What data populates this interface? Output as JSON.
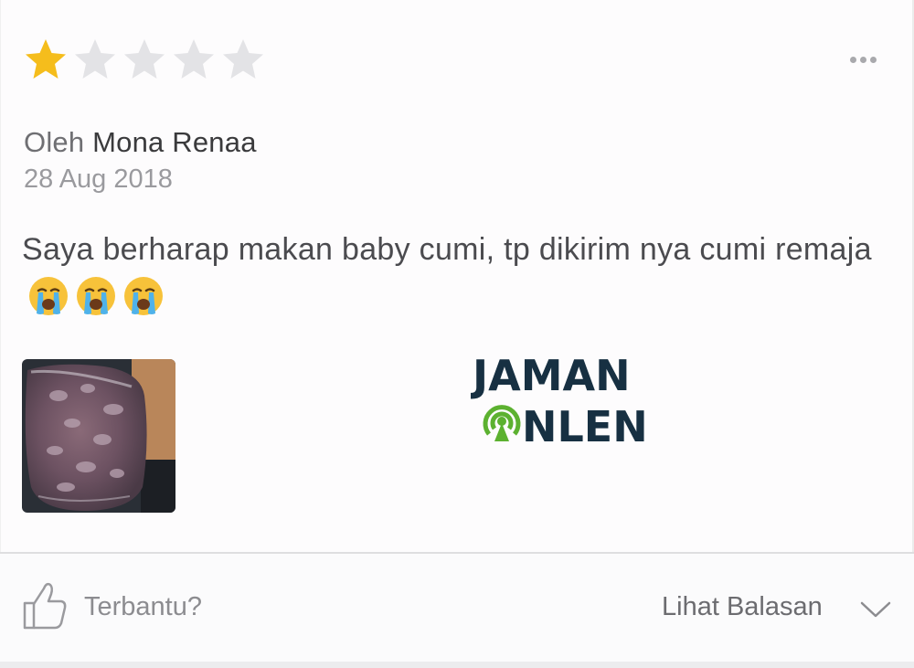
{
  "review": {
    "rating": 1,
    "rating_max": 5,
    "author_prefix": "Oleh",
    "author_name": "Mona Renaa",
    "date": "28 Aug 2018",
    "text": "Saya berharap makan baby cumi, tp dikirim nya cumi remaja",
    "emojis": [
      "crying-face",
      "crying-face",
      "crying-face"
    ]
  },
  "footer": {
    "helpful_label": "Terbantu?",
    "replies_label": "Lihat Balasan"
  },
  "watermark": {
    "line1": "JAMAN",
    "line2": "NLEN"
  },
  "colors": {
    "star_filled": "#f5bd1c",
    "star_empty": "#e3e3e6",
    "watermark_dark": "#173042",
    "watermark_green": "#5cb130"
  }
}
